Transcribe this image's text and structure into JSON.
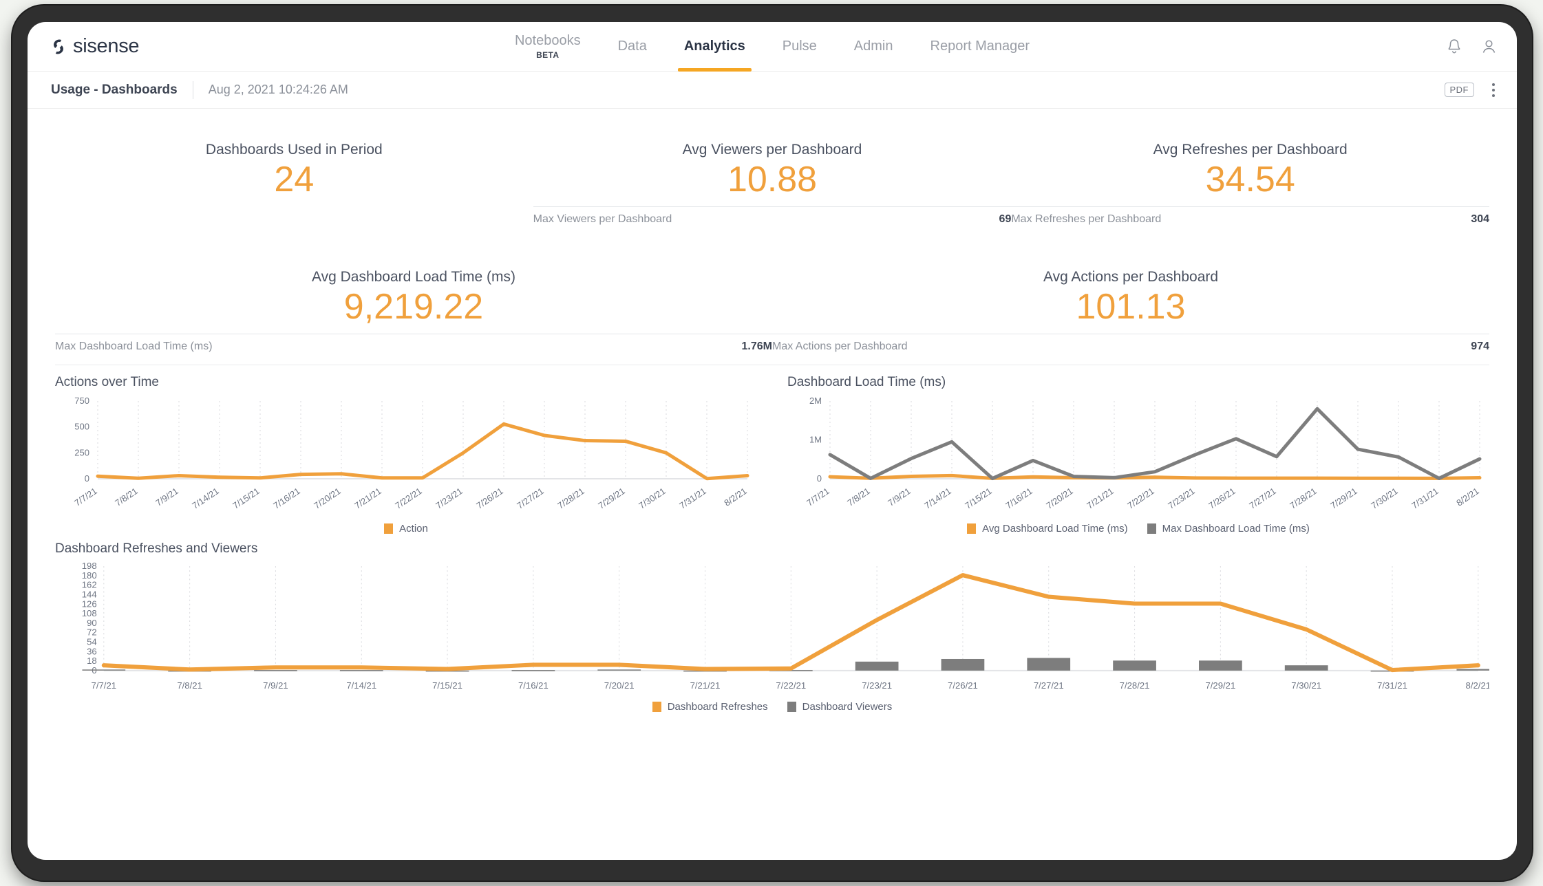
{
  "brand": {
    "name": "sisense",
    "logo_icon": "sisense-logo-icon",
    "accent": "#f5a623"
  },
  "nav": {
    "items": [
      {
        "label": "Notebooks",
        "sub": "BETA",
        "active": false
      },
      {
        "label": "Data",
        "sub": "",
        "active": false
      },
      {
        "label": "Analytics",
        "sub": "",
        "active": true
      },
      {
        "label": "Pulse",
        "sub": "",
        "active": false
      },
      {
        "label": "Admin",
        "sub": "",
        "active": false
      },
      {
        "label": "Report Manager",
        "sub": "",
        "active": false
      }
    ],
    "icons": [
      {
        "name": "notifications-bell-icon"
      },
      {
        "name": "user-account-icon"
      }
    ]
  },
  "breadcrumb": {
    "title": "Usage - Dashboards",
    "timestamp": "Aug 2, 2021 10:24:26 AM",
    "pdf_label": "PDF",
    "menu_icon": "kebab-menu-icon"
  },
  "kpis": {
    "row1": [
      {
        "title": "Dashboards Used in Period",
        "value": "24",
        "sub_label": "",
        "sub_value": "",
        "has_sub": false
      },
      {
        "title": "Avg Viewers per Dashboard",
        "value": "10.88",
        "sub_label": "Max Viewers per Dashboard",
        "sub_value": "69",
        "has_sub": true
      },
      {
        "title": "Avg Refreshes per Dashboard",
        "value": "34.54",
        "sub_label": "Max Refreshes per Dashboard",
        "sub_value": "304",
        "has_sub": true
      }
    ],
    "row2": [
      {
        "title": "Avg Dashboard Load Time (ms)",
        "value": "9,219.22",
        "sub_label": "Max Dashboard Load Time (ms)",
        "sub_value": "1.76M",
        "has_sub": true
      },
      {
        "title": "Avg Actions per Dashboard",
        "value": "101.13",
        "sub_label": "Max Actions per Dashboard",
        "sub_value": "974",
        "has_sub": true
      }
    ]
  },
  "chart_data": [
    {
      "id": "actions-over-time",
      "type": "line",
      "title": "Actions over Time",
      "xlabel": "",
      "ylabel": "",
      "grid": true,
      "legend_position": "bottom",
      "ylim": [
        0,
        750
      ],
      "yticks": [
        0,
        250,
        500,
        750
      ],
      "categories": [
        "7/7/21",
        "7/8/21",
        "7/9/21",
        "7/14/21",
        "7/15/21",
        "7/16/21",
        "7/20/21",
        "7/21/21",
        "7/22/21",
        "7/23/21",
        "7/26/21",
        "7/27/21",
        "7/28/21",
        "7/29/21",
        "7/30/21",
        "7/31/21",
        "8/2/21"
      ],
      "series": [
        {
          "name": "Action",
          "color": "#f0a03c",
          "values": [
            25,
            5,
            30,
            15,
            8,
            42,
            48,
            8,
            8,
            250,
            528,
            418,
            368,
            362,
            250,
            2,
            30
          ]
        }
      ]
    },
    {
      "id": "dashboard-load-time",
      "type": "line",
      "title": "Dashboard Load Time (ms)",
      "xlabel": "",
      "ylabel": "",
      "grid": true,
      "legend_position": "bottom",
      "ylim": [
        0,
        2000000
      ],
      "yticks": [
        0,
        1000000,
        2000000
      ],
      "ytick_labels": [
        "0",
        "1M",
        "2M"
      ],
      "categories": [
        "7/7/21",
        "7/8/21",
        "7/9/21",
        "7/14/21",
        "7/15/21",
        "7/16/21",
        "7/20/21",
        "7/21/21",
        "7/22/21",
        "7/23/21",
        "7/26/21",
        "7/27/21",
        "7/28/21",
        "7/29/21",
        "7/30/21",
        "7/31/21",
        "8/2/21"
      ],
      "series": [
        {
          "name": "Avg Dashboard Load Time (ms)",
          "color": "#f0a03c",
          "values": [
            52000,
            14000,
            62000,
            82000,
            10000,
            48000,
            26000,
            22000,
            40000,
            20000,
            16000,
            16000,
            15000,
            14000,
            14000,
            12000,
            26000
          ]
        },
        {
          "name": "Max Dashboard Load Time (ms)",
          "color": "#7d7d7d",
          "values": [
            620000,
            10000,
            520000,
            950000,
            8000,
            470000,
            60000,
            28000,
            180000,
            620000,
            1030000,
            570000,
            1800000,
            760000,
            560000,
            10000,
            510000
          ]
        }
      ]
    },
    {
      "id": "dashboard-refreshes-and-viewers",
      "type": "combo",
      "title": "Dashboard Refreshes and Viewers",
      "xlabel": "",
      "ylabel": "",
      "grid": true,
      "legend_position": "bottom",
      "ylim": [
        0,
        198
      ],
      "yticks": [
        0,
        18,
        36,
        54,
        72,
        90,
        108,
        126,
        144,
        162,
        180,
        198
      ],
      "categories": [
        "7/7/21",
        "7/8/21",
        "7/9/21",
        "7/14/21",
        "7/15/21",
        "7/16/21",
        "7/20/21",
        "7/21/21",
        "7/22/21",
        "7/23/21",
        "7/26/21",
        "7/27/21",
        "7/28/21",
        "7/29/21",
        "7/30/21",
        "7/31/21",
        "8/2/21"
      ],
      "series": [
        {
          "name": "Dashboard Refreshes",
          "type": "line",
          "color": "#f0a03c",
          "values": [
            10,
            2,
            6,
            6,
            3,
            11,
            11,
            3,
            4,
            96,
            181,
            140,
            127,
            127,
            78,
            1,
            10
          ]
        },
        {
          "name": "Dashboard Viewers",
          "type": "bar",
          "color": "#7d7d7d",
          "values": [
            2,
            0,
            1,
            1,
            0,
            1,
            2,
            0,
            1,
            17,
            22,
            24,
            19,
            19,
            10,
            0,
            3
          ]
        }
      ]
    }
  ]
}
